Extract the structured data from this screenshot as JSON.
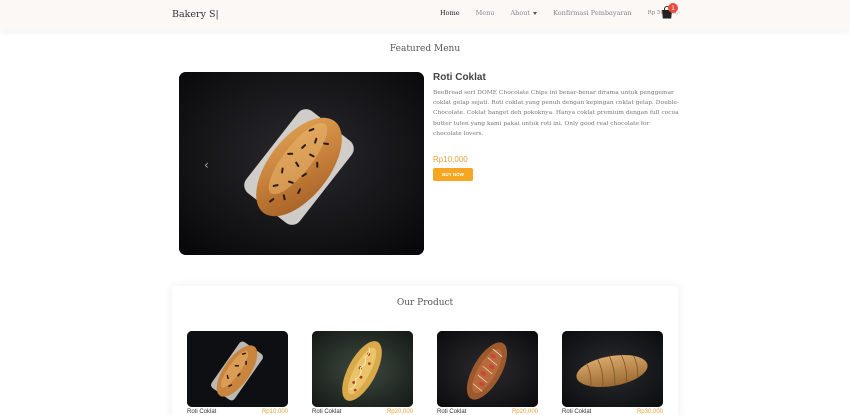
{
  "navbar": {
    "brand": "Bakery S|",
    "links": [
      {
        "label": "Home",
        "active": true
      },
      {
        "label": "Menu",
        "active": false
      },
      {
        "label": "About",
        "active": false,
        "dropdown": true
      },
      {
        "label": "Konfirmasi Pembayaran",
        "active": false
      }
    ],
    "cart_total": "Rp 50.000,-",
    "cart_icon": "shopping-bag-icon",
    "cart_count": "1"
  },
  "featured": {
    "title": "Featured Menu",
    "name": "Roti Coklat",
    "description": "BeeBread seri DOME Chocolate Chips ini benar-benar dirama untuk penggemar coklat gelap sejati. Roti coklat yang penuh dengan kepingan coklat gelap. Double-Chocolate. Coklat banget deh pokoknya. Hanya coklat premium dengan full cocoa butter tulen yang kami pakai untuk roti ini. Only good real chocolate for chocolate lovers.",
    "price": "Rp10,000",
    "buy_label": "BUY NOW",
    "prev_icon": "chevron-left-icon"
  },
  "products": {
    "title": "Our Product",
    "items": [
      {
        "name": "Roti Coklat",
        "price": "Rp10,000",
        "kind": "choco"
      },
      {
        "name": "Roti Coklat",
        "price": "Rp20,000",
        "kind": "sausage"
      },
      {
        "name": "Roti Coklat",
        "price": "Rp20,000",
        "kind": "redglaze"
      },
      {
        "name": "Roti Coklat",
        "price": "Rp30,000",
        "kind": "plain"
      }
    ]
  },
  "colors": {
    "accent": "#f5a623",
    "price": "#e8a23a",
    "badge": "#e74c3c",
    "navbar_bg": "#fbf8f5"
  }
}
